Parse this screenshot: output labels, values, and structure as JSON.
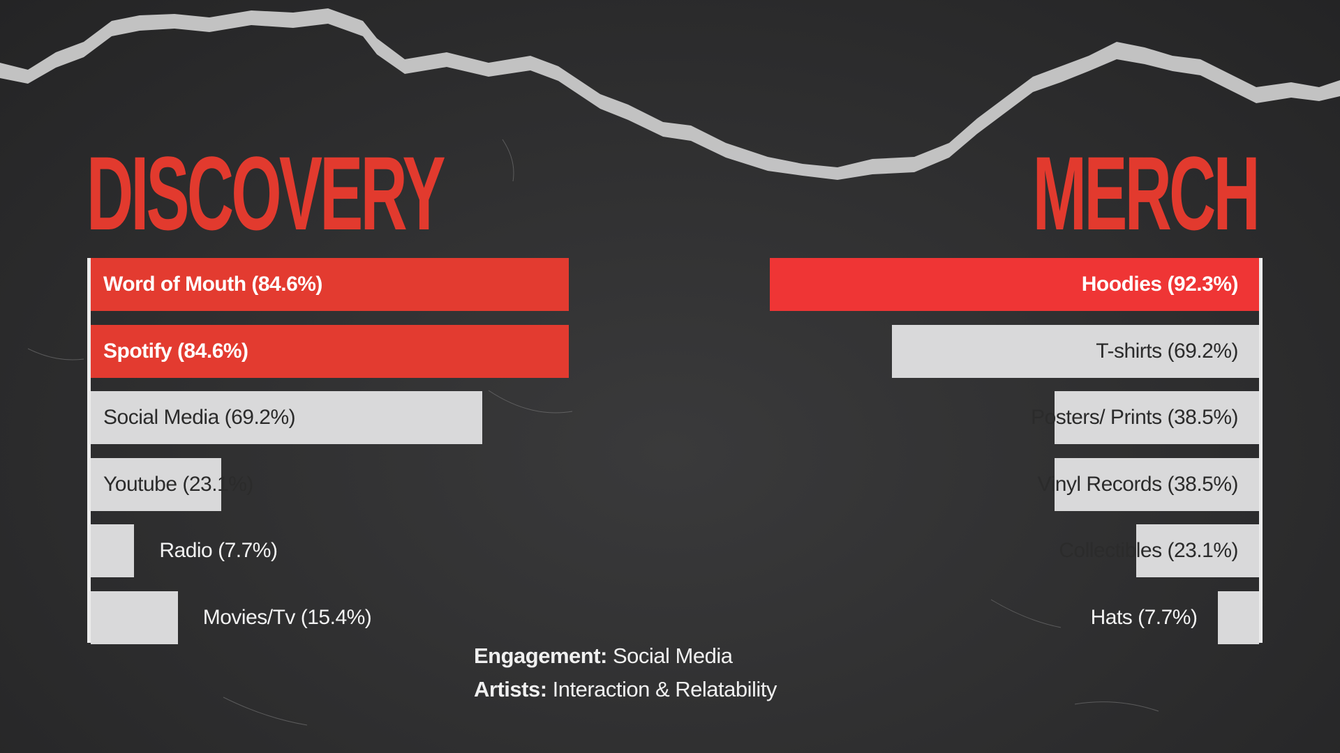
{
  "colors": {
    "highlight_bar": "#e33b30",
    "highlight_bar_merch": "#ef3535",
    "neutral_bar": "#d9d9da",
    "heading": "#e23a2e",
    "background": "#2e2e2f"
  },
  "slide": {
    "discovery_title": "DISCOVERY",
    "merch_title": "MERCH"
  },
  "chart_data": [
    {
      "type": "bar",
      "orientation": "horizontal",
      "title": "DISCOVERY",
      "align": "left",
      "max_value": 100,
      "categories": [
        "Word of Mouth",
        "Spotify",
        "Social Media",
        "Youtube",
        "Radio",
        "Movies/Tv"
      ],
      "values": [
        84.6,
        84.6,
        69.2,
        23.1,
        7.7,
        15.4
      ],
      "labels": [
        "Word of Mouth (84.6%)",
        "Spotify (84.6%)",
        "Social Media  (69.2%)",
        "Youtube (23.1%)",
        "Radio (7.7%)",
        "Movies/Tv  (15.4%)"
      ],
      "highlighted": [
        true,
        true,
        false,
        false,
        false,
        false
      ],
      "label_outside": [
        false,
        false,
        false,
        false,
        true,
        true
      ]
    },
    {
      "type": "bar",
      "orientation": "horizontal",
      "title": "MERCH",
      "align": "right",
      "max_value": 100,
      "categories": [
        "Hoodies",
        "T-shirts",
        "Posters/ Prints",
        "Vinyl Records",
        "Collectibles",
        "Hats"
      ],
      "values": [
        92.3,
        69.2,
        38.5,
        38.5,
        23.1,
        7.7
      ],
      "labels": [
        "Hoodies (92.3%)",
        "T-shirts (69.2%)",
        "Posters/ Prints (38.5%)",
        "Vinyl Records  (38.5%)",
        "Collectibles (23.1%)",
        "Hats (7.7%)"
      ],
      "highlighted": [
        true,
        false,
        false,
        false,
        false,
        false
      ],
      "label_outside": [
        false,
        false,
        false,
        false,
        false,
        true
      ]
    }
  ],
  "footer": {
    "engagement_label": "Engagement:",
    "engagement_value": " Social Media",
    "artists_label": "Artists:",
    "artists_value": " Interaction & Relatability"
  }
}
